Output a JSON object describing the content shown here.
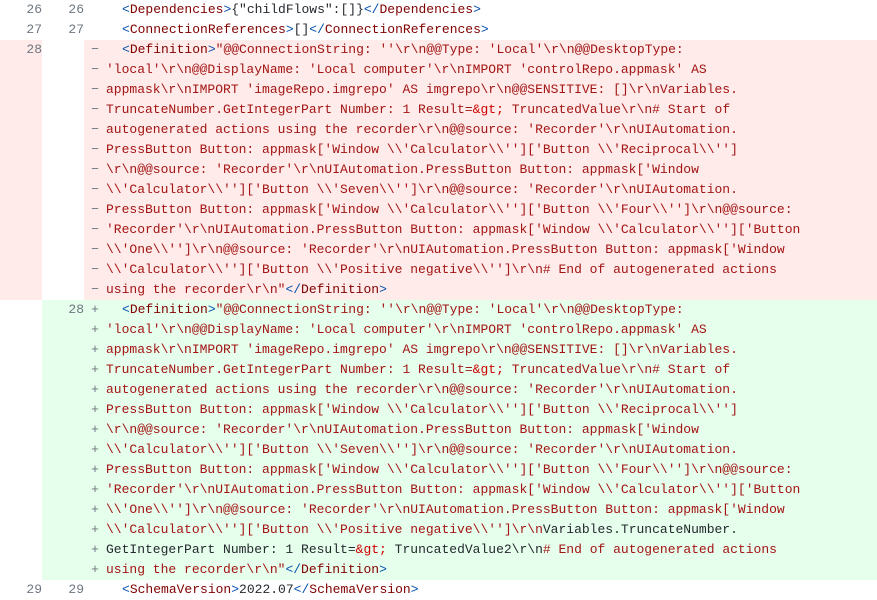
{
  "rows": [
    {
      "type": "ctx",
      "oldLn": "26",
      "newLn": "26",
      "marker": "",
      "segments": [
        {
          "cls": "indent",
          "t": "  "
        },
        {
          "cls": "tag-bracket",
          "t": "<"
        },
        {
          "cls": "tag-name",
          "t": "Dependencies"
        },
        {
          "cls": "tag-bracket",
          "t": ">"
        },
        {
          "cls": "plain",
          "t": "{\"childFlows\":[]}"
        },
        {
          "cls": "tag-bracket",
          "t": "</"
        },
        {
          "cls": "tag-name-close",
          "t": "Dependencies"
        },
        {
          "cls": "tag-bracket",
          "t": ">"
        }
      ]
    },
    {
      "type": "ctx",
      "oldLn": "27",
      "newLn": "27",
      "marker": "",
      "segments": [
        {
          "cls": "indent",
          "t": "  "
        },
        {
          "cls": "tag-bracket",
          "t": "<"
        },
        {
          "cls": "tag-name",
          "t": "ConnectionReferences"
        },
        {
          "cls": "tag-bracket",
          "t": ">"
        },
        {
          "cls": "plain",
          "t": "[]"
        },
        {
          "cls": "tag-bracket",
          "t": "</"
        },
        {
          "cls": "tag-name-close",
          "t": "ConnectionReferences"
        },
        {
          "cls": "tag-bracket",
          "t": ">"
        }
      ]
    },
    {
      "type": "del",
      "oldLn": "28",
      "newLn": "",
      "marker": "−",
      "segments": [
        {
          "cls": "indent",
          "t": "   "
        },
        {
          "cls": "tag-bracket",
          "t": "<"
        },
        {
          "cls": "tag-name",
          "t": "Definition"
        },
        {
          "cls": "tag-bracket",
          "t": ">"
        },
        {
          "cls": "str-red",
          "t": "\"@@ConnectionString: ''\\r\\n@@Type: 'Local'\\r\\n@@DesktopType: "
        }
      ]
    },
    {
      "type": "del",
      "oldLn": "",
      "newLn": "",
      "marker": "−",
      "segments": [
        {
          "cls": "str-red",
          "t": "'local'\\r\\n@@DisplayName: 'Local computer'\\r\\nIMPORT 'controlRepo.appmask' AS "
        }
      ]
    },
    {
      "type": "del",
      "oldLn": "",
      "newLn": "",
      "marker": "−",
      "segments": [
        {
          "cls": "str-red",
          "t": "appmask\\r\\nIMPORT 'imageRepo.imgrepo' AS imgrepo\\r\\n@@SENSITIVE: []\\r\\nVariables."
        }
      ]
    },
    {
      "type": "del",
      "oldLn": "",
      "newLn": "",
      "marker": "−",
      "segments": [
        {
          "cls": "str-red",
          "t": "TruncateNumber.GetIntegerPart Number: 1 Result="
        },
        {
          "cls": "amp",
          "t": "&gt;"
        },
        {
          "cls": "str-red",
          "t": " TruncatedValue\\r\\n# Start of "
        }
      ]
    },
    {
      "type": "del",
      "oldLn": "",
      "newLn": "",
      "marker": "−",
      "segments": [
        {
          "cls": "str-red",
          "t": "autogenerated actions using the recorder\\r\\n@@source: 'Recorder'\\r\\nUIAutomation."
        }
      ]
    },
    {
      "type": "del",
      "oldLn": "",
      "newLn": "",
      "marker": "−",
      "segments": [
        {
          "cls": "str-red",
          "t": "PressButton Button: appmask['Window \\\\'Calculator\\\\'']['Button \\\\'Reciprocal\\\\'']"
        }
      ]
    },
    {
      "type": "del",
      "oldLn": "",
      "newLn": "",
      "marker": "−",
      "segments": [
        {
          "cls": "str-red",
          "t": "\\r\\n@@source: 'Recorder'\\r\\nUIAutomation.PressButton Button: appmask['Window "
        }
      ]
    },
    {
      "type": "del",
      "oldLn": "",
      "newLn": "",
      "marker": "−",
      "segments": [
        {
          "cls": "str-red",
          "t": "\\\\'Calculator\\\\'']['Button \\\\'Seven\\\\'']\\r\\n@@source: 'Recorder'\\r\\nUIAutomation."
        }
      ]
    },
    {
      "type": "del",
      "oldLn": "",
      "newLn": "",
      "marker": "−",
      "segments": [
        {
          "cls": "str-red",
          "t": "PressButton Button: appmask['Window \\\\'Calculator\\\\'']['Button \\\\'Four\\\\'']\\r\\n@@source: "
        }
      ]
    },
    {
      "type": "del",
      "oldLn": "",
      "newLn": "",
      "marker": "−",
      "segments": [
        {
          "cls": "str-red",
          "t": "'Recorder'\\r\\nUIAutomation.PressButton Button: appmask['Window \\\\'Calculator\\\\'']['Button "
        }
      ]
    },
    {
      "type": "del",
      "oldLn": "",
      "newLn": "",
      "marker": "−",
      "segments": [
        {
          "cls": "str-red",
          "t": "\\\\'One\\\\'']\\r\\n@@source: 'Recorder'\\r\\nUIAutomation.PressButton Button: appmask['Window "
        }
      ]
    },
    {
      "type": "del",
      "oldLn": "",
      "newLn": "",
      "marker": "−",
      "segments": [
        {
          "cls": "str-red",
          "t": "\\\\'Calculator\\\\'']['Button \\\\'Positive negative\\\\'']\\r\\n# End of autogenerated actions "
        }
      ]
    },
    {
      "type": "del",
      "oldLn": "",
      "newLn": "",
      "marker": "−",
      "segments": [
        {
          "cls": "str-red",
          "t": "using the recorder\\r\\n\""
        },
        {
          "cls": "tag-bracket",
          "t": "</"
        },
        {
          "cls": "tag-name-close",
          "t": "Definition"
        },
        {
          "cls": "tag-bracket",
          "t": ">"
        }
      ]
    },
    {
      "type": "add",
      "oldLn": "",
      "newLn": "28",
      "marker": "+",
      "segments": [
        {
          "cls": "indent",
          "t": "   "
        },
        {
          "cls": "tag-bracket",
          "t": "<"
        },
        {
          "cls": "tag-name",
          "t": "Definition"
        },
        {
          "cls": "tag-bracket",
          "t": ">"
        },
        {
          "cls": "str-red",
          "t": "\"@@ConnectionString: ''\\r\\n@@Type: 'Local'\\r\\n@@DesktopType: "
        }
      ]
    },
    {
      "type": "add",
      "oldLn": "",
      "newLn": "",
      "marker": "+",
      "segments": [
        {
          "cls": "str-red",
          "t": "'local'\\r\\n@@DisplayName: 'Local computer'\\r\\nIMPORT 'controlRepo.appmask' AS "
        }
      ]
    },
    {
      "type": "add",
      "oldLn": "",
      "newLn": "",
      "marker": "+",
      "segments": [
        {
          "cls": "str-red",
          "t": "appmask\\r\\nIMPORT 'imageRepo.imgrepo' AS imgrepo\\r\\n@@SENSITIVE: []\\r\\nVariables."
        }
      ]
    },
    {
      "type": "add",
      "oldLn": "",
      "newLn": "",
      "marker": "+",
      "segments": [
        {
          "cls": "str-red",
          "t": "TruncateNumber.GetIntegerPart Number: 1 Result="
        },
        {
          "cls": "amp",
          "t": "&gt;"
        },
        {
          "cls": "str-red",
          "t": " TruncatedValue\\r\\n# Start of "
        }
      ]
    },
    {
      "type": "add",
      "oldLn": "",
      "newLn": "",
      "marker": "+",
      "segments": [
        {
          "cls": "str-red",
          "t": "autogenerated actions using the recorder\\r\\n@@source: 'Recorder'\\r\\nUIAutomation."
        }
      ]
    },
    {
      "type": "add",
      "oldLn": "",
      "newLn": "",
      "marker": "+",
      "segments": [
        {
          "cls": "str-red",
          "t": "PressButton Button: appmask['Window \\\\'Calculator\\\\'']['Button \\\\'Reciprocal\\\\'']"
        }
      ]
    },
    {
      "type": "add",
      "oldLn": "",
      "newLn": "",
      "marker": "+",
      "segments": [
        {
          "cls": "str-red",
          "t": "\\r\\n@@source: 'Recorder'\\r\\nUIAutomation.PressButton Button: appmask['Window "
        }
      ]
    },
    {
      "type": "add",
      "oldLn": "",
      "newLn": "",
      "marker": "+",
      "segments": [
        {
          "cls": "str-red",
          "t": "\\\\'Calculator\\\\'']['Button \\\\'Seven\\\\'']\\r\\n@@source: 'Recorder'\\r\\nUIAutomation."
        }
      ]
    },
    {
      "type": "add",
      "oldLn": "",
      "newLn": "",
      "marker": "+",
      "segments": [
        {
          "cls": "str-red",
          "t": "PressButton Button: appmask['Window \\\\'Calculator\\\\'']['Button \\\\'Four\\\\'']\\r\\n@@source: "
        }
      ]
    },
    {
      "type": "add",
      "oldLn": "",
      "newLn": "",
      "marker": "+",
      "segments": [
        {
          "cls": "str-red",
          "t": "'Recorder'\\r\\nUIAutomation.PressButton Button: appmask['Window \\\\'Calculator\\\\'']['Button "
        }
      ]
    },
    {
      "type": "add",
      "oldLn": "",
      "newLn": "",
      "marker": "+",
      "segments": [
        {
          "cls": "str-red",
          "t": "\\\\'One\\\\'']\\r\\n@@source: 'Recorder'\\r\\nUIAutomation.PressButton Button: appmask['Window "
        }
      ]
    },
    {
      "type": "add",
      "oldLn": "",
      "newLn": "",
      "marker": "+",
      "segments": [
        {
          "cls": "str-red",
          "t": "\\\\'Calculator\\\\'']['Button \\\\'Positive negative\\\\'']\\r\\n"
        },
        {
          "cls": "plain",
          "t": "Variables.TruncateNumber."
        }
      ]
    },
    {
      "type": "add",
      "oldLn": "",
      "newLn": "",
      "marker": "+",
      "segments": [
        {
          "cls": "plain",
          "t": "GetIntegerPart Number: 1 Result="
        },
        {
          "cls": "amp",
          "t": "&gt;"
        },
        {
          "cls": "plain",
          "t": " TruncatedValue2\\r\\n"
        },
        {
          "cls": "str-red",
          "t": "# End of autogenerated actions "
        }
      ]
    },
    {
      "type": "add",
      "oldLn": "",
      "newLn": "",
      "marker": "+",
      "segments": [
        {
          "cls": "str-red",
          "t": "using the recorder\\r\\n\""
        },
        {
          "cls": "tag-bracket",
          "t": "</"
        },
        {
          "cls": "tag-name-close",
          "t": "Definition"
        },
        {
          "cls": "tag-bracket",
          "t": ">"
        }
      ]
    },
    {
      "type": "ctx",
      "oldLn": "29",
      "newLn": "29",
      "marker": "",
      "segments": [
        {
          "cls": "indent",
          "t": "  "
        },
        {
          "cls": "tag-bracket",
          "t": "<"
        },
        {
          "cls": "tag-name",
          "t": "SchemaVersion"
        },
        {
          "cls": "tag-bracket",
          "t": ">"
        },
        {
          "cls": "plain",
          "t": "2022.07"
        },
        {
          "cls": "tag-bracket",
          "t": "</"
        },
        {
          "cls": "tag-name-close",
          "t": "SchemaVersion"
        },
        {
          "cls": "tag-bracket",
          "t": ">"
        }
      ]
    }
  ]
}
